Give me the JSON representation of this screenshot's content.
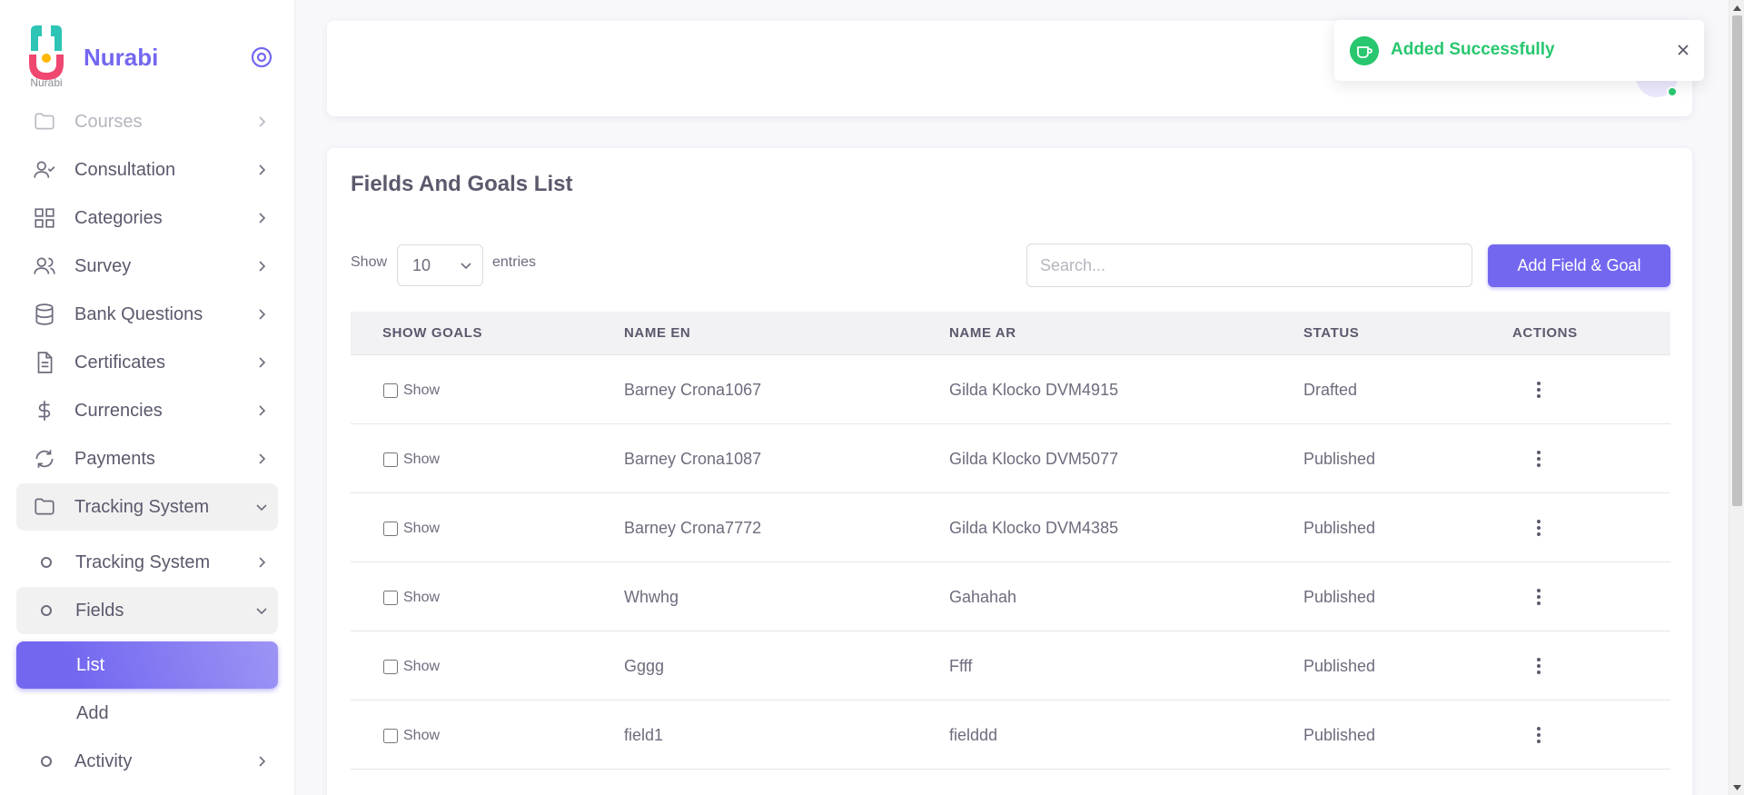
{
  "brand": {
    "name": "Nurabi",
    "logo_caption": "Nurabi"
  },
  "sidebar": {
    "items": [
      {
        "label": "Courses",
        "icon": "folder-icon"
      },
      {
        "label": "Consultation",
        "icon": "user-check-icon"
      },
      {
        "label": "Categories",
        "icon": "grid-icon"
      },
      {
        "label": "Survey",
        "icon": "users-icon"
      },
      {
        "label": "Bank Questions",
        "icon": "database-icon"
      },
      {
        "label": "Certificates",
        "icon": "file-text-icon"
      },
      {
        "label": "Currencies",
        "icon": "dollar-icon"
      },
      {
        "label": "Payments",
        "icon": "refresh-icon"
      },
      {
        "label": "Tracking System",
        "icon": "folder-icon"
      }
    ],
    "sub_items": [
      {
        "label": "Tracking System"
      },
      {
        "label": "Fields"
      }
    ],
    "fields_children": [
      {
        "label": "List"
      },
      {
        "label": "Add"
      }
    ],
    "after": [
      {
        "label": "Activity"
      }
    ]
  },
  "main": {
    "title": "Fields And Goals List",
    "show_label": "Show",
    "entries_value": "10",
    "entries_label": "entries",
    "search_placeholder": "Search...",
    "add_button": "Add Field & Goal",
    "columns": [
      "SHOW GOALS",
      "NAME EN",
      "NAME AR",
      "STATUS",
      "ACTIONS"
    ],
    "rows": [
      {
        "show": "Show",
        "name_en": "Barney Crona1067",
        "name_ar": "Gilda Klocko DVM4915",
        "status": "Drafted"
      },
      {
        "show": "Show",
        "name_en": "Barney Crona1087",
        "name_ar": "Gilda Klocko DVM5077",
        "status": "Published"
      },
      {
        "show": "Show",
        "name_en": "Barney Crona7772",
        "name_ar": "Gilda Klocko DVM4385",
        "status": "Published"
      },
      {
        "show": "Show",
        "name_en": "Whwhg",
        "name_ar": "Gahahah",
        "status": "Published"
      },
      {
        "show": "Show",
        "name_en": "Gggg",
        "name_ar": "Ffff",
        "status": "Published"
      },
      {
        "show": "Show",
        "name_en": "field1",
        "name_ar": "fielddd",
        "status": "Published"
      }
    ]
  },
  "toast": {
    "message": "Added Successfully",
    "color": "#28c76f"
  },
  "colors": {
    "primary": "#7367f0",
    "success": "#28c76f",
    "text": "#5d586c"
  }
}
